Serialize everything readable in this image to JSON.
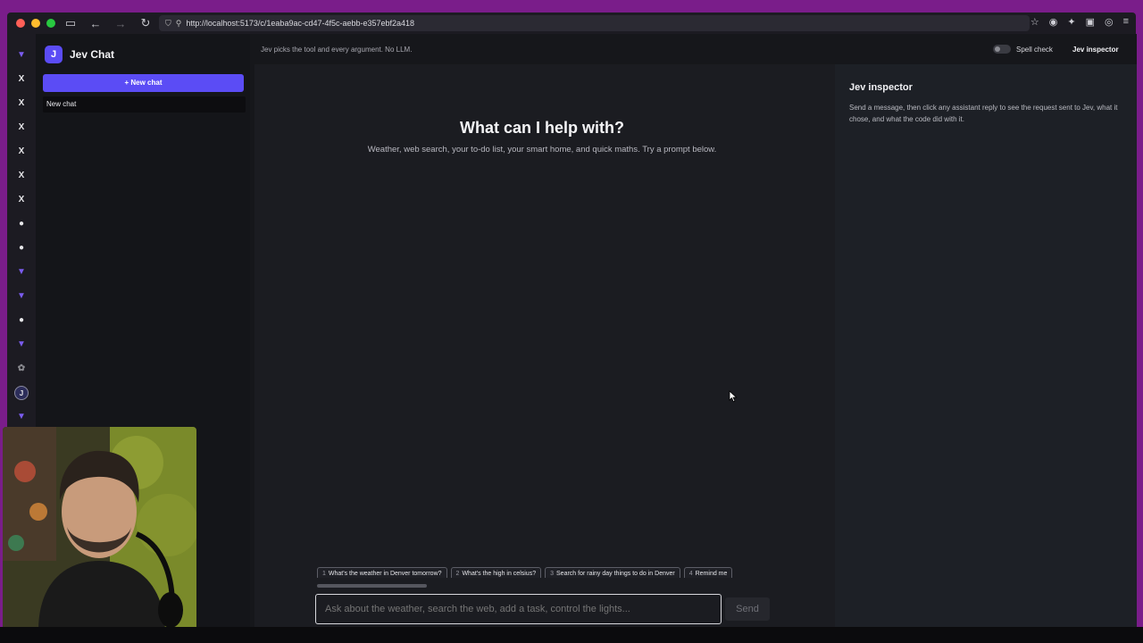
{
  "browser": {
    "url": "http://localhost:5173/c/1eaba9ac-cd47-4f5c-aebb-e357ebf2a418"
  },
  "sidebar": {
    "brand_logo": "J",
    "brand_name": "Jev Chat",
    "new_chat_label": "+ New chat",
    "chats": [
      {
        "label": "New chat"
      }
    ]
  },
  "topbar": {
    "tagline": "Jev picks the tool and every argument. No LLM.",
    "spell_check_label": "Spell check",
    "spell_check_on": false,
    "inspector_button_label": "Jev inspector"
  },
  "main": {
    "title": "What can I help with?",
    "subtitle": "Weather, web search, your to-do list, your smart home, and quick maths. Try a prompt below.",
    "suggestions": [
      {
        "num": "1",
        "text": "What's the weather in Denver tomorrow?"
      },
      {
        "num": "2",
        "text": "What's the high in celsius?"
      },
      {
        "num": "3",
        "text": "Search for rainy day things to do in Denver"
      },
      {
        "num": "4",
        "text": "Remind me"
      }
    ],
    "input_placeholder": "Ask about the weather, search the web, add a task, control the lights...",
    "send_label": "Send"
  },
  "inspector": {
    "title": "Jev inspector",
    "description": "Send a message, then click any assistant reply to see the request sent to Jev, what it chose, and what the code did with it."
  },
  "colors": {
    "accent": "#5b4cf5",
    "frame": "#7a1d8a"
  }
}
